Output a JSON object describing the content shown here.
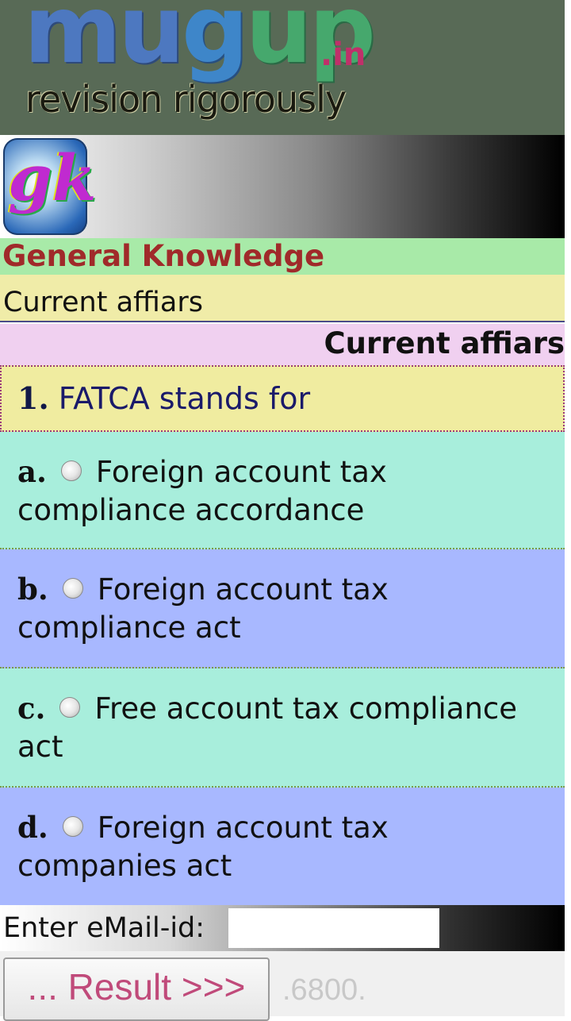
{
  "header": {
    "logo_mu": "mu",
    "logo_g": "g",
    "logo_up": "up",
    "logo_tld": ".in",
    "tagline": "revision rigorously"
  },
  "category": {
    "icon": "gk-icon",
    "icon_text": "gk",
    "title": "General Knowledge",
    "subcategory": "Current affiars",
    "section_title": "Current affiars"
  },
  "question": {
    "number": "1.",
    "text": "FATCA stands for"
  },
  "options": [
    {
      "letter": "a.",
      "text": "Foreign account tax compliance accordance"
    },
    {
      "letter": "b.",
      "text": "Foreign account tax compliance act"
    },
    {
      "letter": "c.",
      "text": "Free account tax compliance act"
    },
    {
      "letter": "d.",
      "text": "Foreign account tax companies act"
    }
  ],
  "email": {
    "label": "Enter eMail-id:",
    "value": ""
  },
  "result_button": "... Result >>>",
  "counter": ".6800.",
  "colors": {
    "banner": "#586a56",
    "category_bg": "#a8eaa8",
    "subcategory_bg": "#f0eca8",
    "section_bg": "#f0d0f0",
    "option_green": "#a8eedc",
    "option_blue": "#a8b8ff"
  }
}
